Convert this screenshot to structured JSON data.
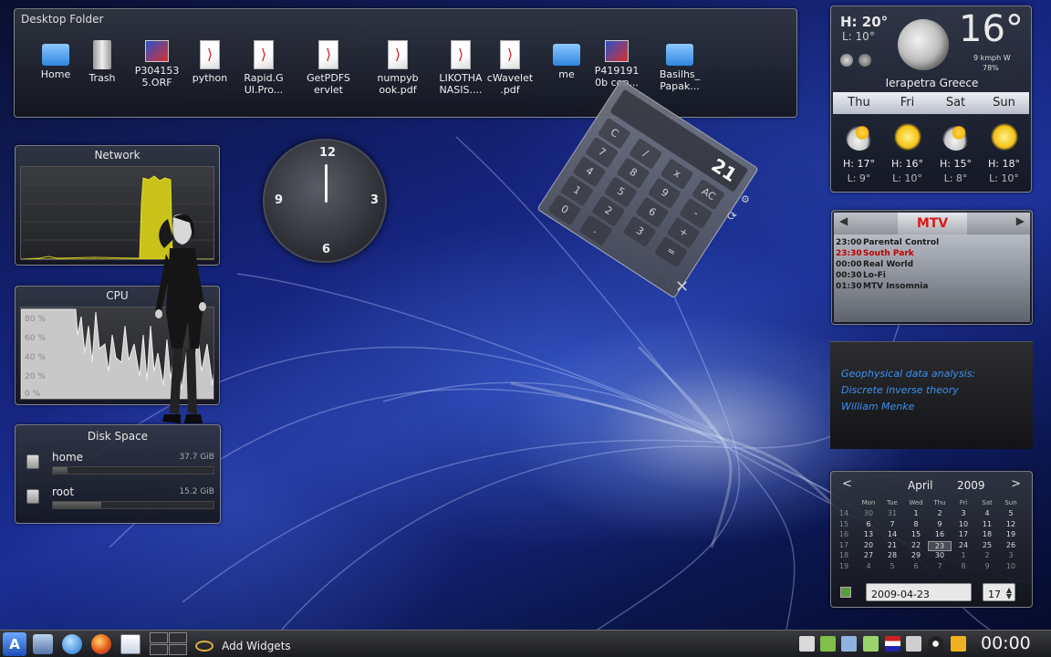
{
  "desktop_folder": {
    "title": "Desktop Folder",
    "items": [
      {
        "label": "Home",
        "icon": "home-folder-icon"
      },
      {
        "label": "Trash",
        "icon": "trash-icon"
      },
      {
        "label": "P304153\n5.ORF",
        "icon": "image-file-icon"
      },
      {
        "label": "python",
        "icon": "pdf-file-icon"
      },
      {
        "label": "Rapid.G\nUI.Pro...",
        "icon": "pdf-file-icon"
      },
      {
        "label": "GetPDFS\nervlet",
        "icon": "pdf-file-icon"
      },
      {
        "label": "numpyb\nook.pdf",
        "icon": "pdf-file-icon"
      },
      {
        "label": "LIKOTHA\nNASIS....",
        "icon": "pdf-file-icon"
      },
      {
        "label": "cWavelet\n.pdf",
        "icon": "pdf-file-icon"
      },
      {
        "label": "me",
        "icon": "folder-icon"
      },
      {
        "label": "P419191\n0b cop...",
        "icon": "image-file-icon"
      },
      {
        "label": "Basilhs_\nPapak...",
        "icon": "folder-icon"
      }
    ]
  },
  "network": {
    "title": "Network"
  },
  "cpu": {
    "title": "CPU",
    "y_labels": [
      "80 %",
      "60 %",
      "40 %",
      "20 %",
      "0 %"
    ]
  },
  "disk": {
    "title": "Disk Space",
    "drives": [
      {
        "name": "home",
        "size": "37.7 GiB",
        "used": 0.09
      },
      {
        "name": "root",
        "size": "15.2 GiB",
        "used": 0.3
      }
    ]
  },
  "clock": {
    "numbers": {
      "top": "12",
      "right": "3",
      "bottom": "6",
      "left": "9"
    }
  },
  "calculator": {
    "display": "21",
    "keys": [
      "C",
      "/",
      "x",
      "AC",
      "7",
      "8",
      "9",
      "-",
      "4",
      "5",
      "6",
      "+",
      "1",
      "2",
      "3",
      "=",
      "0",
      "."
    ]
  },
  "weather": {
    "high": "H: 20°",
    "low": "L: 10°",
    "current_temp": "16°",
    "wind": "9 kmph W",
    "humidity": "78%",
    "location": "Ierapetra Greece",
    "forecast": [
      {
        "day": "Thu",
        "icon": "partly-cloudy-icon",
        "high": "H: 17°",
        "low": "L: 9°"
      },
      {
        "day": "Fri",
        "icon": "sunny-icon",
        "high": "H: 16°",
        "low": "L: 10°"
      },
      {
        "day": "Sat",
        "icon": "partly-cloudy-icon",
        "high": "H: 15°",
        "low": "L: 8°"
      },
      {
        "day": "Sun",
        "icon": "sunny-icon",
        "high": "H: 18°",
        "low": "L: 10°"
      }
    ]
  },
  "tv_guide": {
    "channel_logo": "MTV",
    "programs": [
      {
        "time": "23:00",
        "title": "Parental Control",
        "color": "#1a1a1a"
      },
      {
        "time": "23:30",
        "title": "South Park",
        "color": "#c00000"
      },
      {
        "time": "00:00",
        "title": "Real World",
        "color": "#1a1a1a"
      },
      {
        "time": "00:30",
        "title": "Lo-Fi",
        "color": "#1a1a1a"
      },
      {
        "time": "01:30",
        "title": "MTV Insomnia",
        "color": "#1a1a1a"
      }
    ]
  },
  "notes": {
    "lines": [
      "Geophysical data analysis:",
      "Discrete inverse theory",
      "William Menke"
    ]
  },
  "calendar": {
    "month": "April",
    "year": "2009",
    "weekdays": [
      "Mon",
      "Tue",
      "Wed",
      "Thu",
      "Fri",
      "Sat",
      "Sun"
    ],
    "weeks": [
      {
        "wk": "14",
        "days": [
          "30",
          "31",
          "1",
          "2",
          "3",
          "4",
          "5"
        ]
      },
      {
        "wk": "15",
        "days": [
          "6",
          "7",
          "8",
          "9",
          "10",
          "11",
          "12"
        ]
      },
      {
        "wk": "16",
        "days": [
          "13",
          "14",
          "15",
          "16",
          "17",
          "18",
          "19"
        ]
      },
      {
        "wk": "17",
        "days": [
          "20",
          "21",
          "22",
          "23",
          "24",
          "25",
          "26"
        ]
      },
      {
        "wk": "18",
        "days": [
          "27",
          "28",
          "29",
          "30",
          "1",
          "2",
          "3"
        ]
      },
      {
        "wk": "19",
        "days": [
          "4",
          "5",
          "6",
          "7",
          "8",
          "9",
          "10"
        ]
      }
    ],
    "date_value": "2009-04-23",
    "week_value": "17"
  },
  "taskbar": {
    "add_widgets": "Add Widgets",
    "clock": "00:00"
  }
}
